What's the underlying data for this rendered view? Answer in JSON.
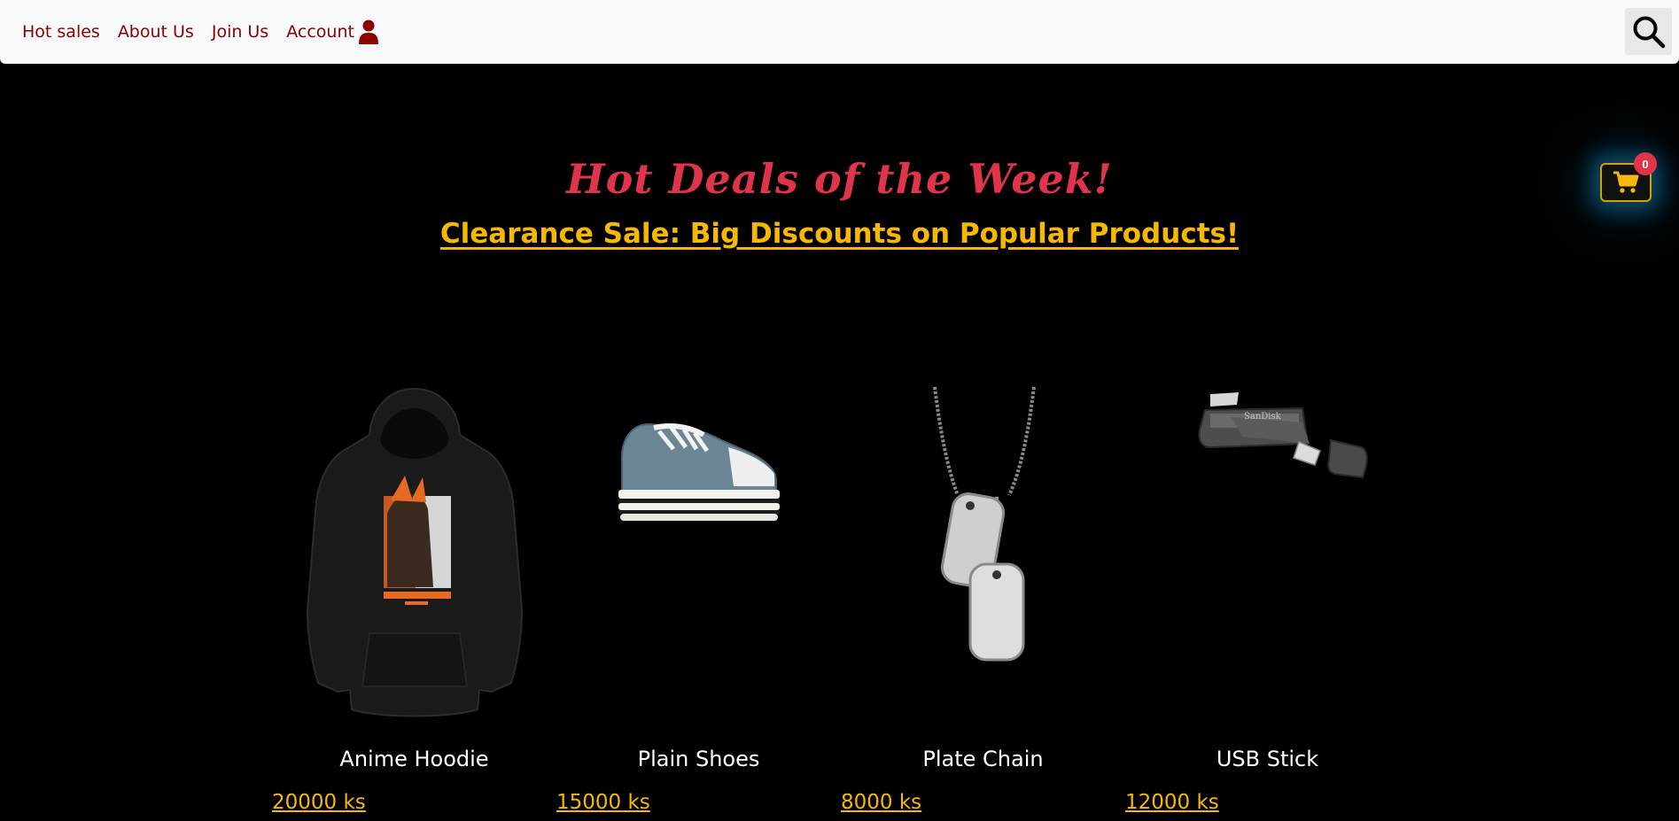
{
  "nav": {
    "links": [
      "Hot sales",
      "About Us",
      "Join Us",
      "Account"
    ],
    "account_icon": "user-icon",
    "search_icon": "search-icon"
  },
  "cart": {
    "icon": "shopping-cart-icon",
    "count": "0",
    "accent": "#d5a100",
    "badge_color": "#e0344a"
  },
  "hero": {
    "title": "Hot Deals of the Week!",
    "subtitle": "Clearance Sale: Big Discounts on Popular Products!"
  },
  "colors": {
    "nav_text": "#8b0000",
    "title": "#e0344a",
    "highlight": "#f6b800",
    "background": "#000000"
  },
  "products": [
    {
      "name": "Anime Hoodie",
      "price": "20000 ks",
      "image": "hoodie"
    },
    {
      "name": "Plain Shoes",
      "price": "15000 ks",
      "image": "sneaker"
    },
    {
      "name": "Plate Chain",
      "price": "8000 ks",
      "image": "dog-tag-necklace"
    },
    {
      "name": "USB Stick",
      "price": "12000 ks",
      "image": "usb-stick"
    }
  ]
}
